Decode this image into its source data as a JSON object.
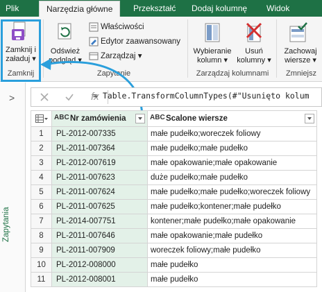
{
  "tabs": [
    "Plik",
    "Narzędzia główne",
    "Przekształć",
    "Dodaj kolumnę",
    "Widok"
  ],
  "ribbon": {
    "close": {
      "button_line1": "Zamknij i",
      "button_line2": "załaduj",
      "group": "Zamknij"
    },
    "query": {
      "refresh_line1": "Odśwież",
      "refresh_line2": "podgląd",
      "properties": "Właściwości",
      "advanced_editor": "Edytor zaawansowany",
      "manage": "Zarządzaj",
      "group": "Zapytanie"
    },
    "columns": {
      "choose_line1": "Wybieranie",
      "choose_line2": "kolumn",
      "remove_line1": "Usuń",
      "remove_line2": "kolumny",
      "group": "Zarządzaj kolumnami"
    },
    "rows": {
      "keep_line1": "Zachowaj",
      "keep_line2": "wiersze",
      "group": "Zmniejsz"
    }
  },
  "formula_bar": {
    "fx": "fx",
    "formula": "= Table.TransformColumnTypes(#\"Usunięto kolum"
  },
  "queries_pane": {
    "label": "Zapytania",
    "chevron": ">"
  },
  "table": {
    "type_label": "ABC",
    "columns": [
      "Nr zamówienia",
      "Scalone wiersze"
    ],
    "rows": [
      [
        "1",
        "PL-2012-007335",
        "małe pudełko;woreczek foliowy"
      ],
      [
        "2",
        "PL-2011-007364",
        "małe pudełko;małe pudełko"
      ],
      [
        "3",
        "PL-2012-007619",
        "małe opakowanie;małe opakowanie"
      ],
      [
        "4",
        "PL-2011-007623",
        "duże pudełko;małe pudełko"
      ],
      [
        "5",
        "PL-2011-007624",
        "małe pudełko;małe pudełko;woreczek foliowy"
      ],
      [
        "6",
        "PL-2011-007625",
        "małe pudełko;kontener;małe pudełko"
      ],
      [
        "7",
        "PL-2014-007751",
        "kontener;małe pudełko;małe opakowanie"
      ],
      [
        "8",
        "PL-2011-007646",
        "małe opakowanie;małe pudełko"
      ],
      [
        "9",
        "PL-2011-007909",
        "woreczek foliowy;małe pudełko"
      ],
      [
        "10",
        "PL-2012-008000",
        "małe pudełko"
      ],
      [
        "11",
        "PL-2012-008001",
        "małe pudełko"
      ]
    ]
  },
  "colors": {
    "tab_bar": "#1e7145",
    "highlight": "#2a9fdc",
    "selected_column": "#e3f1e8"
  }
}
